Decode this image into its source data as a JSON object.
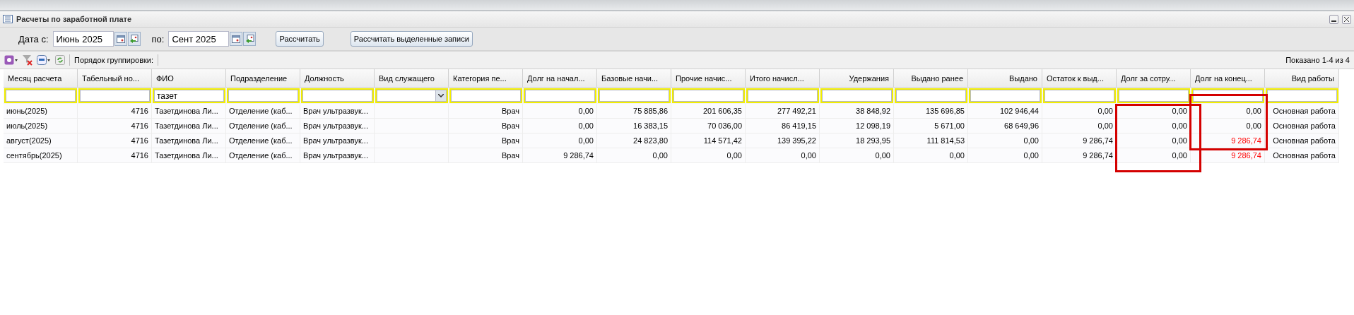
{
  "window": {
    "title": "Расчеты по заработной плате"
  },
  "filters": {
    "from_label": "Дата с:",
    "from_value": "Июнь 2025",
    "to_label": "по:",
    "to_value": "Сент 2025"
  },
  "buttons": [
    "Рассчитать",
    "Рассчитать выделенные записи"
  ],
  "toolbar": {
    "grouping_label": "Порядок группировки:",
    "pager": "Показано 1-4 из 4"
  },
  "table": {
    "columns": [
      {
        "label": "Месяц расчета",
        "kind": "text"
      },
      {
        "label": "Табельный но...",
        "kind": "text"
      },
      {
        "label": "ФИО",
        "kind": "text",
        "filter_value": "тазет"
      },
      {
        "label": "Подразделение",
        "kind": "text"
      },
      {
        "label": "Должность",
        "kind": "text"
      },
      {
        "label": "Вид служащего",
        "kind": "select"
      },
      {
        "label": "Категория пе...",
        "kind": "text"
      },
      {
        "label": "Долг на начал...",
        "kind": "text"
      },
      {
        "label": "Базовые начи...",
        "kind": "text"
      },
      {
        "label": "Прочие начис...",
        "kind": "text"
      },
      {
        "label": "Итого начисл...",
        "kind": "text"
      },
      {
        "label": "Удержания",
        "kind": "text"
      },
      {
        "label": "Выдано ранее",
        "kind": "text"
      },
      {
        "label": "Выдано",
        "kind": "text"
      },
      {
        "label": "Остаток к выд...",
        "kind": "text"
      },
      {
        "label": "Долг за сотру...",
        "kind": "text"
      },
      {
        "label": "Долг на конец...",
        "kind": "text"
      },
      {
        "label": "Вид работы",
        "kind": "text"
      }
    ],
    "rows": [
      {
        "end_debt_red": false,
        "cells": [
          "июнь(2025)",
          "4716",
          "Тазетдинова Ли...",
          "Отделение (каб...",
          "Врач ультразвук...",
          null,
          "Врач",
          "0,00",
          "75 885,86",
          "201 606,35",
          "277 492,21",
          "38 848,92",
          "135 696,85",
          "102 946,44",
          "0,00",
          "0,00",
          "0,00",
          "Основная работа"
        ]
      },
      {
        "end_debt_red": false,
        "cells": [
          "июль(2025)",
          "4716",
          "Тазетдинова Ли...",
          "Отделение (каб...",
          "Врач ультразвук...",
          null,
          "Врач",
          "0,00",
          "16 383,15",
          "70 036,00",
          "86 419,15",
          "12 098,19",
          "5 671,00",
          "68 649,96",
          "0,00",
          "0,00",
          "0,00",
          "Основная работа"
        ]
      },
      {
        "end_debt_red": true,
        "cells": [
          "август(2025)",
          "4716",
          "Тазетдинова Ли...",
          "Отделение (каб...",
          "Врач ультразвук...",
          null,
          "Врач",
          "0,00",
          "24 823,80",
          "114 571,42",
          "139 395,22",
          "18 293,95",
          "111 814,53",
          "0,00",
          "9 286,74",
          "0,00",
          "9 286,74",
          "Основная работа"
        ]
      },
      {
        "end_debt_red": true,
        "cells": [
          "сентябрь(2025)",
          "4716",
          "Тазетдинова Ли...",
          "Отделение (каб...",
          "Врач ультразвук...",
          null,
          "Врач",
          "9 286,74",
          "0,00",
          "0,00",
          "0,00",
          "0,00",
          "0,00",
          "0,00",
          "9 286,74",
          "0,00",
          "9 286,74",
          "Основная работа"
        ]
      }
    ]
  },
  "highlights": {
    "employee_debt_framed": true,
    "end_debt_framed": true
  }
}
